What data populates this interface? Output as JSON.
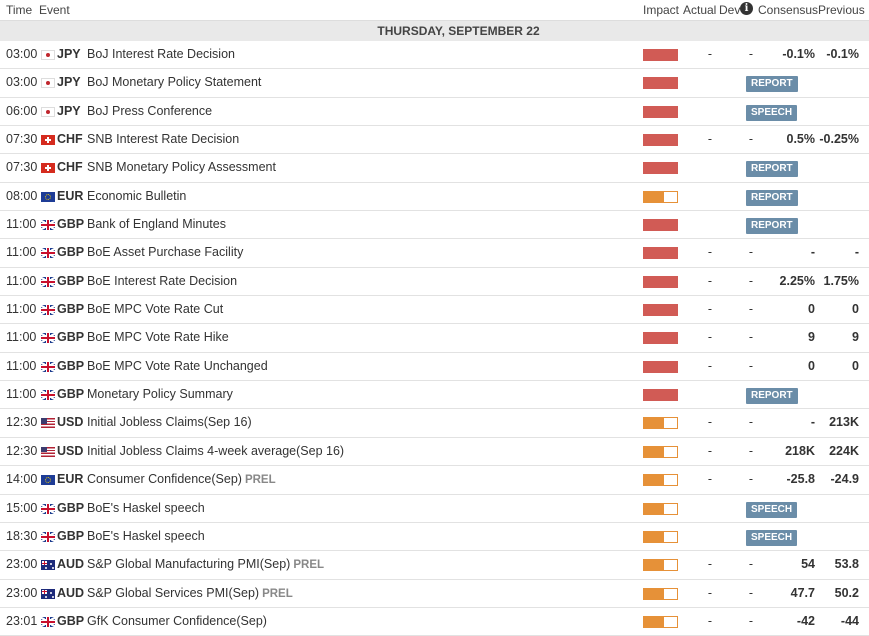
{
  "header": {
    "time": "Time",
    "event": "Event",
    "impact": "Impact",
    "actual": "Actual",
    "dev": "Dev",
    "info": "i",
    "consensus": "Consensus",
    "previous": "Previous"
  },
  "day_label": "THURSDAY, SEPTEMBER 22",
  "colors": {
    "high_impact": "#d15b55",
    "medium_impact": "#e69138",
    "badge": "#6b8da8"
  },
  "rows": [
    {
      "time": "03:00",
      "flag": "japan-flag-icon",
      "currency": "JPY",
      "event": "BoJ Interest Rate Decision",
      "prel": "",
      "impact": "high",
      "actual": "-",
      "dev": "-",
      "consensus": "-0.1%",
      "previous": "-0.1%",
      "badge": ""
    },
    {
      "time": "03:00",
      "flag": "japan-flag-icon",
      "currency": "JPY",
      "event": "BoJ Monetary Policy Statement",
      "prel": "",
      "impact": "high",
      "actual": "",
      "dev": "",
      "consensus": "",
      "previous": "",
      "badge": "REPORT"
    },
    {
      "time": "06:00",
      "flag": "japan-flag-icon",
      "currency": "JPY",
      "event": "BoJ Press Conference",
      "prel": "",
      "impact": "high",
      "actual": "",
      "dev": "",
      "consensus": "",
      "previous": "",
      "badge": "SPEECH"
    },
    {
      "time": "07:30",
      "flag": "switzerland-flag-icon",
      "currency": "CHF",
      "event": "SNB Interest Rate Decision",
      "prel": "",
      "impact": "high",
      "actual": "-",
      "dev": "-",
      "consensus": "0.5%",
      "previous": "-0.25%",
      "badge": ""
    },
    {
      "time": "07:30",
      "flag": "switzerland-flag-icon",
      "currency": "CHF",
      "event": "SNB Monetary Policy Assessment",
      "prel": "",
      "impact": "high",
      "actual": "",
      "dev": "",
      "consensus": "",
      "previous": "",
      "badge": "REPORT"
    },
    {
      "time": "08:00",
      "flag": "eu-flag-icon",
      "currency": "EUR",
      "event": "Economic Bulletin",
      "prel": "",
      "impact": "medium",
      "actual": "",
      "dev": "",
      "consensus": "",
      "previous": "",
      "badge": "REPORT"
    },
    {
      "time": "11:00",
      "flag": "uk-flag-icon",
      "currency": "GBP",
      "event": "Bank of England Minutes",
      "prel": "",
      "impact": "high",
      "actual": "",
      "dev": "",
      "consensus": "",
      "previous": "",
      "badge": "REPORT"
    },
    {
      "time": "11:00",
      "flag": "uk-flag-icon",
      "currency": "GBP",
      "event": "BoE Asset Purchase Facility",
      "prel": "",
      "impact": "high",
      "actual": "-",
      "dev": "-",
      "consensus": "-",
      "previous": "-",
      "badge": ""
    },
    {
      "time": "11:00",
      "flag": "uk-flag-icon",
      "currency": "GBP",
      "event": "BoE Interest Rate Decision",
      "prel": "",
      "impact": "high",
      "actual": "-",
      "dev": "-",
      "consensus": "2.25%",
      "previous": "1.75%",
      "badge": ""
    },
    {
      "time": "11:00",
      "flag": "uk-flag-icon",
      "currency": "GBP",
      "event": "BoE MPC Vote Rate Cut",
      "prel": "",
      "impact": "high",
      "actual": "-",
      "dev": "-",
      "consensus": "0",
      "previous": "0",
      "badge": ""
    },
    {
      "time": "11:00",
      "flag": "uk-flag-icon",
      "currency": "GBP",
      "event": "BoE MPC Vote Rate Hike",
      "prel": "",
      "impact": "high",
      "actual": "-",
      "dev": "-",
      "consensus": "9",
      "previous": "9",
      "badge": ""
    },
    {
      "time": "11:00",
      "flag": "uk-flag-icon",
      "currency": "GBP",
      "event": "BoE MPC Vote Rate Unchanged",
      "prel": "",
      "impact": "high",
      "actual": "-",
      "dev": "-",
      "consensus": "0",
      "previous": "0",
      "badge": ""
    },
    {
      "time": "11:00",
      "flag": "uk-flag-icon",
      "currency": "GBP",
      "event": "Monetary Policy Summary",
      "prel": "",
      "impact": "high",
      "actual": "",
      "dev": "",
      "consensus": "",
      "previous": "",
      "badge": "REPORT"
    },
    {
      "time": "12:30",
      "flag": "us-flag-icon",
      "currency": "USD",
      "event": "Initial Jobless Claims(Sep 16)",
      "prel": "",
      "impact": "medium",
      "actual": "-",
      "dev": "-",
      "consensus": "-",
      "previous": "213K",
      "badge": ""
    },
    {
      "time": "12:30",
      "flag": "us-flag-icon",
      "currency": "USD",
      "event": "Initial Jobless Claims 4-week average(Sep 16)",
      "prel": "",
      "impact": "medium",
      "actual": "-",
      "dev": "-",
      "consensus": "218K",
      "previous": "224K",
      "badge": ""
    },
    {
      "time": "14:00",
      "flag": "eu-flag-icon",
      "currency": "EUR",
      "event": "Consumer Confidence(Sep)",
      "prel": "PREL",
      "impact": "medium",
      "actual": "-",
      "dev": "-",
      "consensus": "-25.8",
      "previous": "-24.9",
      "badge": ""
    },
    {
      "time": "15:00",
      "flag": "uk-flag-icon",
      "currency": "GBP",
      "event": "BoE's Haskel speech",
      "prel": "",
      "impact": "medium",
      "actual": "",
      "dev": "",
      "consensus": "",
      "previous": "",
      "badge": "SPEECH"
    },
    {
      "time": "18:30",
      "flag": "uk-flag-icon",
      "currency": "GBP",
      "event": "BoE's Haskel speech",
      "prel": "",
      "impact": "medium",
      "actual": "",
      "dev": "",
      "consensus": "",
      "previous": "",
      "badge": "SPEECH"
    },
    {
      "time": "23:00",
      "flag": "australia-flag-icon",
      "currency": "AUD",
      "event": "S&P Global Manufacturing PMI(Sep)",
      "prel": "PREL",
      "impact": "medium",
      "actual": "-",
      "dev": "-",
      "consensus": "54",
      "previous": "53.8",
      "badge": ""
    },
    {
      "time": "23:00",
      "flag": "australia-flag-icon",
      "currency": "AUD",
      "event": "S&P Global Services PMI(Sep)",
      "prel": "PREL",
      "impact": "medium",
      "actual": "-",
      "dev": "-",
      "consensus": "47.7",
      "previous": "50.2",
      "badge": ""
    },
    {
      "time": "23:01",
      "flag": "uk-flag-icon",
      "currency": "GBP",
      "event": "GfK Consumer Confidence(Sep)",
      "prel": "",
      "impact": "medium",
      "actual": "-",
      "dev": "-",
      "consensus": "-42",
      "previous": "-44",
      "badge": ""
    }
  ]
}
